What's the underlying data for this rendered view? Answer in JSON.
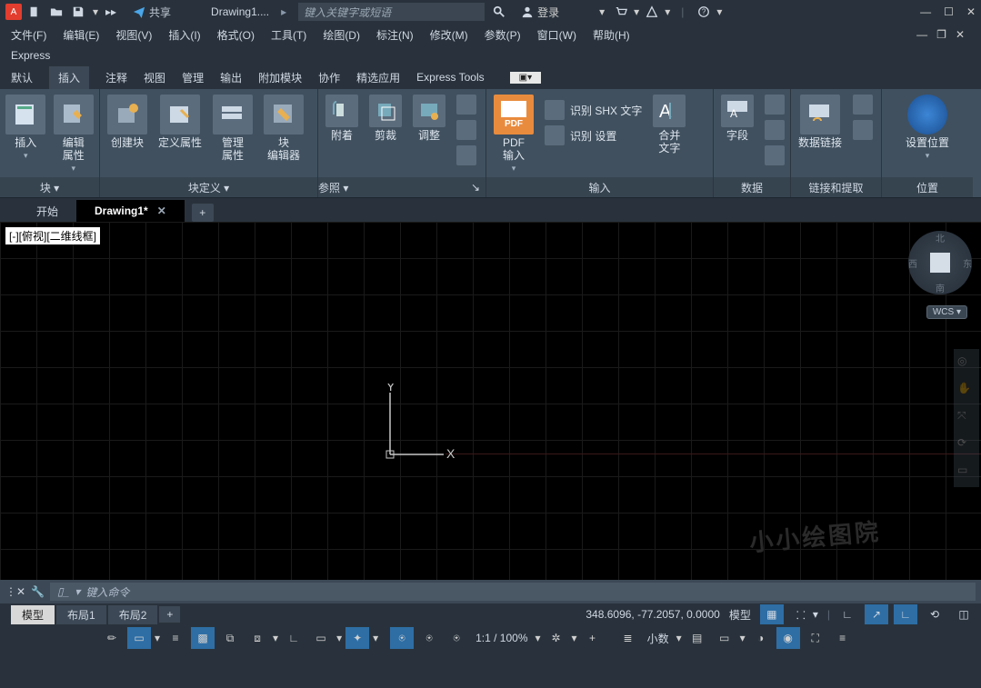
{
  "title_bar": {
    "share_label": "共享",
    "doc_title": "Drawing1....",
    "search_placeholder": "键入关键字或短语",
    "login_label": "登录"
  },
  "menu": {
    "items": [
      "文件(F)",
      "编辑(E)",
      "视图(V)",
      "插入(I)",
      "格式(O)",
      "工具(T)",
      "绘图(D)",
      "标注(N)",
      "修改(M)",
      "参数(P)",
      "窗口(W)",
      "帮助(H)"
    ]
  },
  "express_label": "Express",
  "ribbon_tabs": {
    "items": [
      "默认",
      "插入",
      "注释",
      "视图",
      "管理",
      "输出",
      "附加模块",
      "协作",
      "精选应用",
      "Express Tools"
    ],
    "active_index": 1
  },
  "ribbon": {
    "group_block": {
      "insert": "插入",
      "edit_attr": "编辑\n属性",
      "title": "块 ▾"
    },
    "group_blockdef": {
      "create_block": "创建块",
      "def_attr": "定义属性",
      "manage_attr": "管理\n属性",
      "block_editor": "块\n编辑器",
      "title": "块定义 ▾"
    },
    "group_reference": {
      "attach": "附着",
      "crop": "剪裁",
      "adjust": "调整",
      "title": "参照 ▾"
    },
    "group_input": {
      "pdf_label": "PDF\n输入",
      "recognize_shx": "识别 SHX 文字",
      "recognize_settings": "识别 设置",
      "merge_text": "合并\n文字",
      "title": "输入"
    },
    "group_data": {
      "field": "字段",
      "title": "数据"
    },
    "group_link": {
      "data_link": "数据链接",
      "title": "链接和提取"
    },
    "group_location": {
      "set_location": "设置位置",
      "title": "位置"
    }
  },
  "file_tabs": {
    "start": "开始",
    "drawing": "Drawing1*"
  },
  "viewport_label": "[-][俯视][二维线框]",
  "compass": {
    "n": "北",
    "s": "南",
    "e": "东",
    "w": "西"
  },
  "wcs": "WCS",
  "watermark": "小小绘图院",
  "ucs": {
    "x": "X",
    "y": "Y"
  },
  "cmd": {
    "placeholder": "键入命令"
  },
  "layout_tabs": {
    "model": "模型",
    "layout1": "布局1",
    "layout2": "布局2"
  },
  "status": {
    "coords": "348.6096, -77.2057, 0.0000",
    "model": "模型"
  },
  "status2": {
    "scale": "1:1 / 100%",
    "decimal": "小数"
  }
}
